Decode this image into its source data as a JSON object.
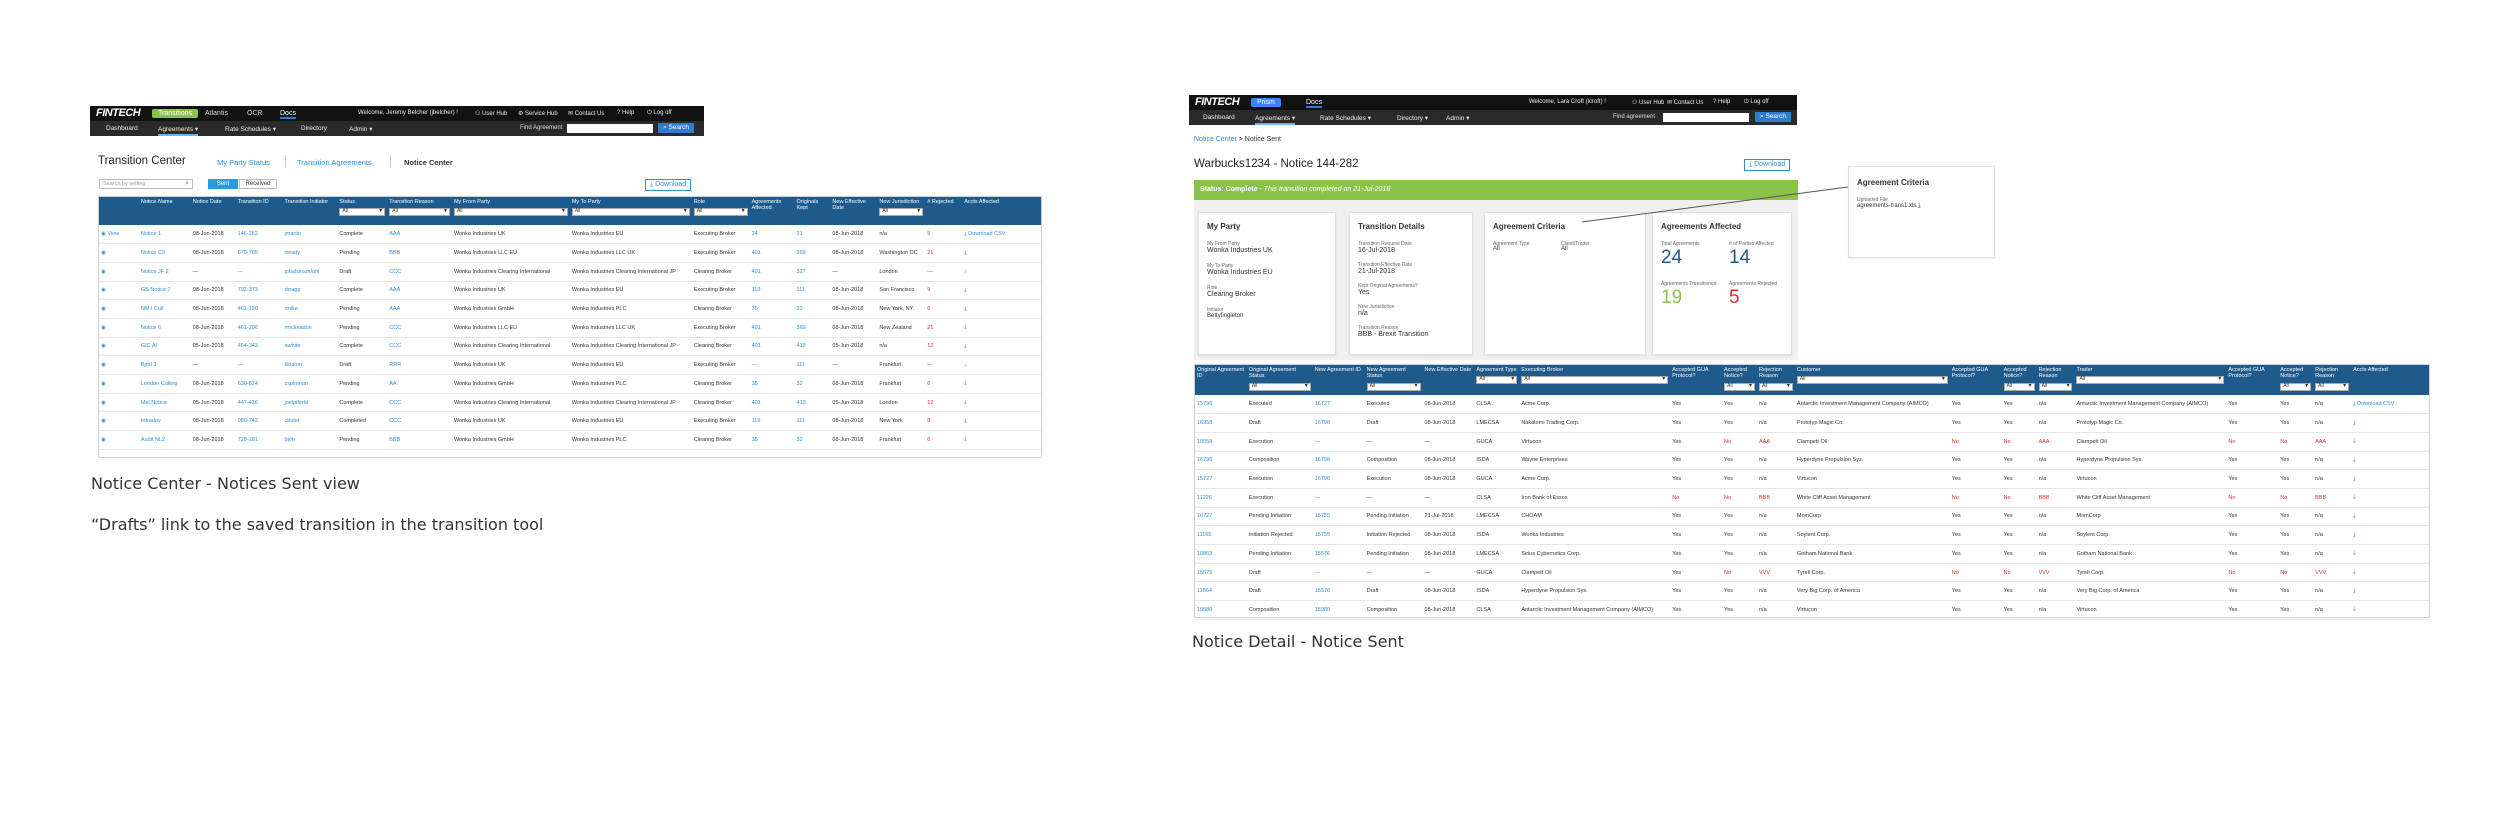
{
  "left": {
    "brand": "FINTECH",
    "top_nav": [
      "Transitions",
      "Atlantis",
      "OCR",
      "Docs"
    ],
    "welcome": "Welcome, Jeremy Belcher (jbelcher) !",
    "right_links": [
      "User Hub",
      "Service Hub",
      "Contact Us",
      "Help",
      "Log off"
    ],
    "nav": [
      "Dashboard",
      "Agreements ▾",
      "Rate Schedules ▾",
      "Directory",
      "Admin ▾"
    ],
    "find_label": "Find Agreement",
    "search_btn": "Search",
    "page_title": "Transition Center",
    "tabs": [
      "My Party Status",
      "Transition Agreements",
      "Notice Center"
    ],
    "download": "Download",
    "search_placeholder": "Search by setting",
    "toggle": [
      "Sent",
      "Received"
    ],
    "columns": [
      "",
      "Notice Name",
      "Notice Date",
      "Transition ID",
      "Transition Initiator",
      "Status",
      "Transition Reason",
      "My From Party",
      "My To Party",
      "Role",
      "Agreements Affected",
      "Originals Kept",
      "New Effective Date",
      "New Jurisdiction",
      "# Rejected",
      "Accts Affected"
    ],
    "rows": [
      [
        "View",
        "Notice 1",
        "08-Jun-2018",
        "146-282",
        "jmartin",
        "Complete",
        "AAA",
        "Wonka Industries UK",
        "Wonka Industries EU",
        "Executing Broker",
        "24",
        "21",
        "08-Jun-2018",
        "n/a",
        "5",
        "Download CSV"
      ],
      [
        "",
        "Notice C3",
        "08-Jun-2018",
        "870-785",
        "rbrady",
        "Pending",
        "BBB",
        "Wonka Industries LLC EU",
        "Wonka Industries LLC UK",
        "Executing Broker",
        "401",
        "369",
        "08-Jun-2018",
        "Washington DC",
        "21",
        ""
      ],
      [
        "",
        "Notice JF 2",
        "—",
        "—",
        "jpbalsinsm/ohl",
        "Draft",
        "CCC",
        "Wonka Industries Clearing International",
        "Wonka Industries Clearing International JP",
        "Clearing Broker",
        "401",
        "327",
        "—",
        "London",
        "—",
        ""
      ],
      [
        "",
        "GS Notice 7",
        "08-Jun-2018",
        "792-373",
        "rbragg",
        "Complete",
        "AAA",
        "Wonka Industries UK",
        "Wonka Industries EU",
        "Executing Broker",
        "119",
        "111",
        "08-Jun-2018",
        "San Francisco",
        "9",
        ""
      ],
      [
        "",
        "NM I Coll",
        "08-Jun-2018",
        "461-190",
        "rmike",
        "Pending",
        "AAA",
        "Wonka Industries GmbH",
        "Wonka Industries PLC",
        "Clearing Broker",
        "35",
        "32",
        "08-Jun-2018",
        "New York, NY",
        "6",
        ""
      ],
      [
        "",
        "Notice 6",
        "08-Jun-2018",
        "461-206",
        "rmckeadon",
        "Pending",
        "CCC",
        "Wonka Industries LLC EU",
        "Wonka Industries LLC UK",
        "Executing Broker",
        "401",
        "369",
        "08-Jun-2018",
        "New Zealand",
        "21",
        ""
      ],
      [
        "",
        "GIC Al",
        "05-Jun-2018",
        "464-343",
        "awhite",
        "Complete",
        "CCC",
        "Wonka Industries Clearing International",
        "Wonka Industries Clearing International JP",
        "Clearing Broker",
        "401",
        "413",
        "05-Jun-2018",
        "n/a",
        "12",
        ""
      ],
      [
        "",
        "Bjnd 3",
        "—",
        "—",
        "kkiaton",
        "Draft",
        "RRR",
        "Wonka Industries UK",
        "Wonka Industries EU",
        "Executing Broker",
        "—",
        "111",
        "—",
        "Frankfurt",
        "—",
        ""
      ],
      [
        "",
        "London Calling",
        "08-Jun-2018",
        "630-824",
        "cspinman",
        "Pending",
        "AA",
        "Wonka Industries GmbH",
        "Wonka Industries PLC",
        "Clearing Broker",
        "35",
        "32",
        "08-Jun-2018",
        "Frankfurt",
        "6",
        ""
      ],
      [
        "",
        "Mel Notice",
        "05-Jun-2018",
        "447-436",
        "joelpiferld",
        "Complete",
        "CCC",
        "Wonka Industries Clearing International",
        "Wonka Industries Clearing International JP",
        "Clearing Broker",
        "401",
        "413",
        "05-Jun-2018",
        "London",
        "12",
        ""
      ],
      [
        "",
        "Intraday",
        "08-Jun-2018",
        "980-742",
        "cbutel",
        "Completed",
        "CCC",
        "Wonka Industries UK",
        "Wonka Industries EU",
        "Executing Broker",
        "119",
        "111",
        "08-Jun-2018",
        "New York",
        "8",
        ""
      ],
      [
        "",
        "Audit NL2",
        "08-Jun-2018",
        "728-181",
        "bjoh",
        "Pending",
        "BBB",
        "Wonka Industries GmbH",
        "Wonka Industries PLC",
        "Clearing Broker",
        "35",
        "32",
        "08-Jun-2018",
        "Frankfurt",
        "6",
        ""
      ]
    ],
    "caption1": "Notice Center - Notices Sent view",
    "caption2": "“Drafts” link to the saved transition in the transition tool"
  },
  "right": {
    "brand": "FINTECH",
    "top_nav": [
      "Prism",
      "Docs"
    ],
    "welcome": "Welcome, Lara Croft (lcroft) !",
    "right_links": [
      "User Hub",
      "Contact Us",
      "Help",
      "Log off"
    ],
    "nav": [
      "Dashboard",
      "Agreements ▾",
      "Rate Schedules ▾",
      "Directory ▾",
      "Admin ▾"
    ],
    "find_label": "Find agreement",
    "search_btn": "Search",
    "breadcrumb_link": "Notice Center",
    "breadcrumb_current": "> Notice Sent",
    "title": "Warbucks1234 - Notice 144-282",
    "download": "Download",
    "status_label": "Status: Complete",
    "status_text": " - This transition completed on 21-Jul-2018",
    "my_party": {
      "title": "My Party",
      "from_label": "My From Party",
      "from": "Wonka Industries UK",
      "to_label": "My To Party",
      "to": "Wonka Industries EU",
      "role_label": "Role",
      "role": "Clearing Broker",
      "init_label": "Initiator",
      "init": "Bettyfingleton"
    },
    "transition": {
      "title": "Transition Details",
      "req_label": "Transition Request Date",
      "req": "16-Jul-2018",
      "eff_label": "Transition Effective Date",
      "eff": "21-Jul-2018",
      "kept_label": "Kept Original Agreements?",
      "kept": "Yes",
      "jur_label": "New Jurisdiction",
      "jur": "n/a",
      "reason_label": "Transition Reason",
      "reason": "BBB - Brexit Transition"
    },
    "criteria": {
      "title": "Agreement Criteria",
      "type_label": "Agreement Type",
      "type": "All",
      "client_label": "Client/Trader",
      "client": "All"
    },
    "affected": {
      "title": "Agreements Affected",
      "total_label": "Total Agreements",
      "total": "24",
      "parties_label": "# of Parties Affected",
      "parties": "14",
      "trans_label": "Agreements Transitioned",
      "trans": "19",
      "rej_label": "Agreements Rejected",
      "rej": "5"
    },
    "popup": {
      "title": "Agreement Criteria",
      "label": "Uploaded File",
      "file": "agreements-trans1.xls"
    },
    "columns": [
      "Original Agreement ID",
      "Original Agreement Status",
      "New Agreement ID",
      "New Agreement Status",
      "New Effective Date",
      "Agreement Type",
      "Executing Broker",
      "Accepted GUA Protocol?",
      "Accepted Notice?",
      "Rejection Reason",
      "Customer",
      "Accepted GUA Protocol?",
      "Accepted Notice?",
      "Rejection Reason",
      "Trader",
      "Accepted GUA Protocol?",
      "Accepted Notice?",
      "Rejection Reason",
      "Accts Affected"
    ],
    "rows": [
      [
        "15796",
        "Executed",
        "16727",
        "Executed",
        "08-Jun-2018",
        "CLSA",
        "Acme Corp.",
        "Yes",
        "Yes",
        "n/a",
        "Antarctic Investment Management Company (AIMCO)",
        "Yes",
        "Yes",
        "n/a",
        "Antarctic Investment Management Company (AIMCO)",
        "Yes",
        "Yes",
        "n/a",
        "Download CSV"
      ],
      [
        "16958",
        "Draft",
        "16798",
        "Draft",
        "08-Jun-2018",
        "LMECSA",
        "Nakatomi Trading Corp.",
        "Yes",
        "Yes",
        "n/a",
        "Prototyp Magic Co.",
        "Yes",
        "Yes",
        "n/a",
        "Prototyp Magic Co.",
        "Yes",
        "Yes",
        "n/a",
        ""
      ],
      [
        "10558",
        "Execution",
        "—",
        "—",
        "—",
        "GUCA",
        "Virtucon",
        "Yes",
        "No",
        "AAA",
        "Clampett Oil",
        "No",
        "No",
        "AAA",
        "Clampett Oil",
        "No",
        "No",
        "AAA",
        ""
      ],
      [
        "16796",
        "Composition",
        "16798",
        "Composition",
        "08-Jun-2018",
        "ISDA",
        "Wayne Enterprises",
        "Yes",
        "Yes",
        "n/a",
        "Hyperdyne Propulsion Sys.",
        "Yes",
        "Yes",
        "n/a",
        "Hyperdyne Propulsion Sys.",
        "Yes",
        "Yes",
        "n/a",
        ""
      ],
      [
        "15727",
        "Execution",
        "16796",
        "Execution",
        "08-Jun-2018",
        "GUCA",
        "Acme Corp.",
        "Yes",
        "Yes",
        "n/a",
        "Virtucon",
        "Yes",
        "Yes",
        "n/a",
        "Virtucon",
        "Yes",
        "Yes",
        "n/a",
        ""
      ],
      [
        "11226",
        "Execution",
        "—",
        "—",
        "—",
        "CLSA",
        "Iron Bank of Essos",
        "No",
        "No",
        "BBB",
        "White Cliff Asset Management",
        "No",
        "No",
        "BBB",
        "White Cliff Asset Management",
        "No",
        "No",
        "BBB",
        ""
      ],
      [
        "10727",
        "Pending Initiation",
        "15755",
        "Pending Initiation",
        "21-Jul-2018",
        "LMECSA",
        "CHOAM",
        "Yes",
        "Yes",
        "n/a",
        "MomCorp",
        "Yes",
        "Yes",
        "n/a",
        "MomCorp",
        "Yes",
        "Yes",
        "n/a",
        ""
      ],
      [
        "11165",
        "Initiation Rejected",
        "15755",
        "Initiation Rejected",
        "08-Jun-2018",
        "ISDA",
        "Wonka Industries",
        "Yes",
        "Yes",
        "n/a",
        "Soylent Corp.",
        "Yes",
        "Yes",
        "n/a",
        "Soylent Corp.",
        "Yes",
        "Yes",
        "n/a",
        ""
      ],
      [
        "10863",
        "Pending Initiation",
        "15576",
        "Pending Initiation",
        "08-Jun-2018",
        "LMECSA",
        "Sirius Cybernetics Corp.",
        "Yes",
        "Yes",
        "n/a",
        "Gotham National Bank",
        "Yes",
        "Yes",
        "n/a",
        "Gotham National Bank",
        "Yes",
        "Yes",
        "n/a",
        ""
      ],
      [
        "15575",
        "Draft",
        "—",
        "—",
        "—",
        "GUCA",
        "Clampett Oil",
        "Yes",
        "No",
        "VVV",
        "Tyrell Corp.",
        "No",
        "No",
        "VVV",
        "Tyrell Corp.",
        "No",
        "No",
        "VVV",
        ""
      ],
      [
        "11864",
        "Draft",
        "15576",
        "Draft",
        "08-Jun-2018",
        "ISDA",
        "Hyperdyne Propulsion Sys.",
        "Yes",
        "Yes",
        "n/a",
        "Very Big Corp. of America",
        "Yes",
        "Yes",
        "n/a",
        "Very Big Corp. of America",
        "Yes",
        "Yes",
        "n/a",
        ""
      ],
      [
        "10580",
        "Composition",
        "15980",
        "Composition",
        "08-Jun-2018",
        "CLSA",
        "Antarctic Investment Management Company (AIMCO)",
        "Yes",
        "Yes",
        "n/a",
        "Virtucon",
        "Yes",
        "Yes",
        "n/a",
        "Virtucon",
        "Yes",
        "Yes",
        "n/a",
        ""
      ]
    ],
    "caption": "Notice Detail - Notice Sent"
  },
  "filter_all": "All"
}
